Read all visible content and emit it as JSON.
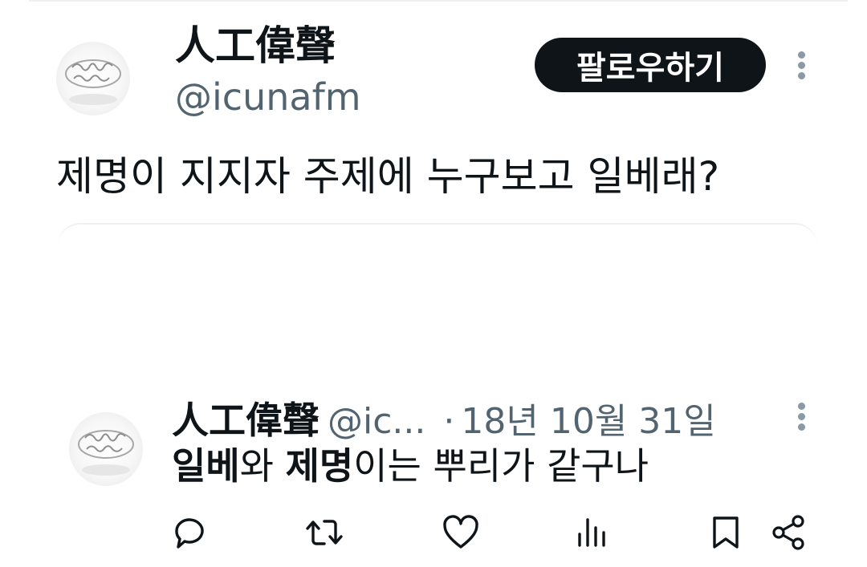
{
  "top_tweet": {
    "author": {
      "display_name": "人工偉聲",
      "handle": "@icunafm",
      "avatar_icon": "ring-photo-avatar"
    },
    "follow_button_label": "팔로우하기",
    "text": "제명이 지지자 주제에 누구보고 일베래?"
  },
  "quoted_reply": {
    "author": {
      "display_name": "人工偉聲",
      "handle": "@ic...",
      "avatar_icon": "ring-photo-avatar"
    },
    "separator": "·",
    "date": "18년 10월 31일",
    "text_parts": [
      {
        "text": "일베",
        "bold": true
      },
      {
        "text": "와 ",
        "bold": false
      },
      {
        "text": "제명",
        "bold": true
      },
      {
        "text": "이는 뿌리가 같구나",
        "bold": false
      }
    ],
    "actions": [
      {
        "icon": "reply-icon"
      },
      {
        "icon": "retweet-icon"
      },
      {
        "icon": "like-icon"
      },
      {
        "icon": "views-icon"
      },
      {
        "icon": "bookmark-icon"
      },
      {
        "icon": "share-icon"
      }
    ]
  },
  "colors": {
    "primary_text": "#0f1419",
    "secondary_text": "#536471",
    "follow_button_bg": "#0f1419",
    "follow_button_text": "#ffffff",
    "divider": "#eef1f3"
  }
}
